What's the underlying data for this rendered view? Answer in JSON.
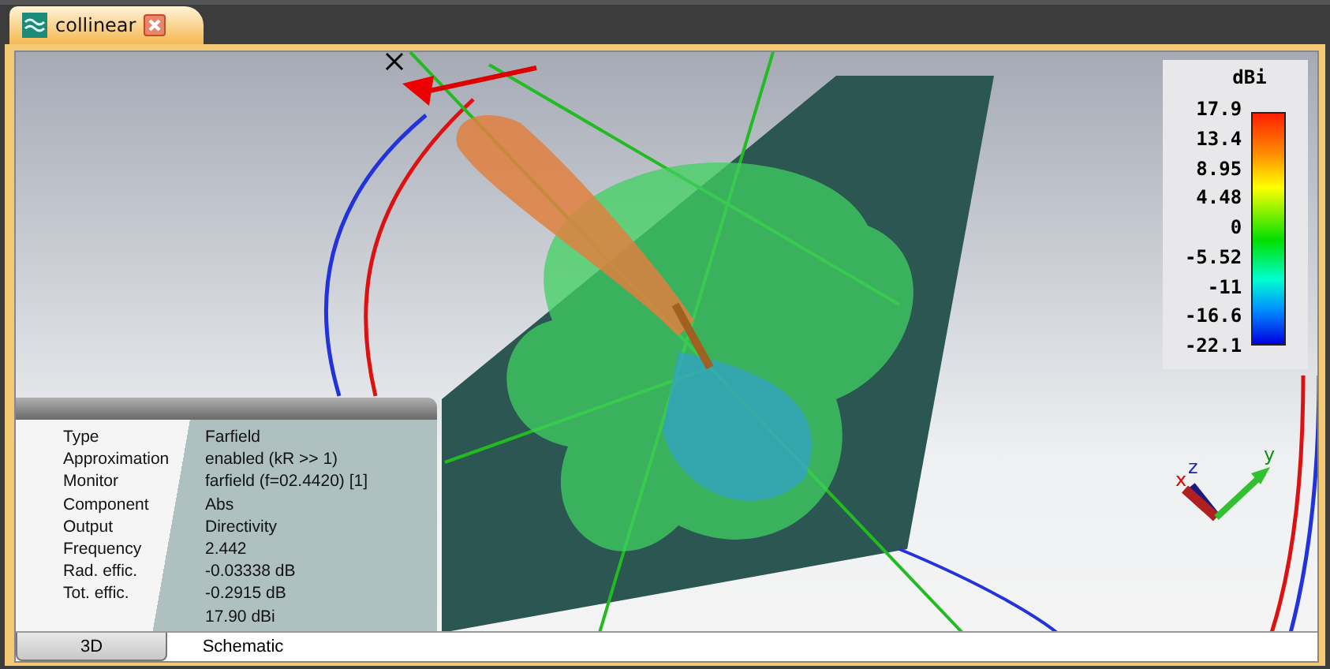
{
  "tab": {
    "title": "collinear"
  },
  "legend": {
    "unit": "dBi",
    "ticks": [
      "17.9",
      "13.4",
      "8.95",
      "4.48",
      "0",
      "-5.52",
      "-11",
      "-16.6",
      "-22.1"
    ]
  },
  "info_panel": {
    "rows": [
      {
        "label": "Type",
        "value": "Farfield"
      },
      {
        "label": "Approximation",
        "value": "enabled (kR >> 1)"
      },
      {
        "label": "Monitor",
        "value": "farfield (f=02.4420) [1]"
      },
      {
        "label": "Component",
        "value": "Abs"
      },
      {
        "label": "Output",
        "value": "Directivity"
      },
      {
        "label": "Frequency",
        "value": "2.442"
      },
      {
        "label": "Rad. effic.",
        "value": "-0.03338 dB"
      },
      {
        "label": "Tot. effic.",
        "value": "-0.2915 dB"
      },
      {
        "value": "17.90 dBi"
      }
    ]
  },
  "axes": {
    "x": "x",
    "y": "y",
    "z": "z"
  },
  "view_tabs": [
    {
      "label": "3D",
      "selected": true
    },
    {
      "label": "Schematic",
      "selected": false
    }
  ]
}
